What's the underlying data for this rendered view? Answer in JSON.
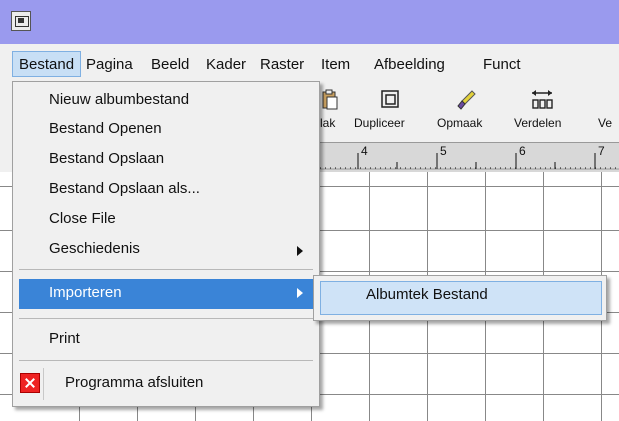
{
  "menubar": {
    "items": [
      "Bestand",
      "Pagina",
      "Beeld",
      "Kader",
      "Raster",
      "Item",
      "Afbeelding",
      "Funct"
    ]
  },
  "toolbar": {
    "items": [
      "lak",
      "Dupliceer",
      "Opmaak",
      "Verdelen",
      "Ve"
    ]
  },
  "ruler": {
    "numbers": [
      "4",
      "5",
      "6",
      "7"
    ]
  },
  "file_menu": {
    "items": [
      "Nieuw albumbestand",
      "Bestand Openen",
      "Bestand Opslaan",
      "Bestand Opslaan als...",
      "Close File",
      "Geschiedenis",
      "Importeren",
      "Print",
      "Programma afsluiten"
    ]
  },
  "import_submenu": {
    "item": "Albumtek Bestand"
  },
  "colors": {
    "titlebar": "#9a9aee",
    "highlight": "#3a84d7",
    "submenu_highlight": "#cfe3f7"
  }
}
